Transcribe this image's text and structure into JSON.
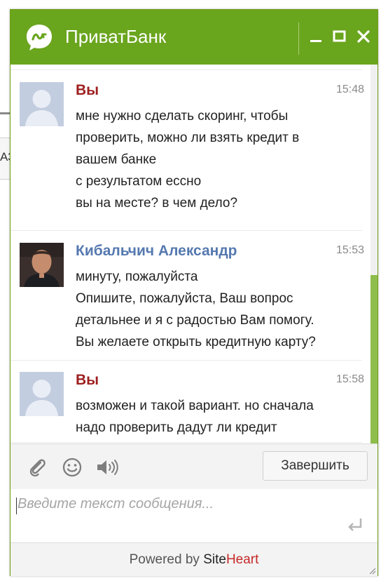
{
  "background": {
    "fragment_text": "АЗ"
  },
  "window": {
    "title": "ПриватБанк",
    "brand_color": "#6aa51e",
    "controls": {
      "minimize_icon": "minimize-icon",
      "maximize_icon": "maximize-icon",
      "close_icon": "close-icon"
    }
  },
  "messages": [
    {
      "author": "Вы",
      "role": "user",
      "time": "15:48",
      "avatar": "default-avatar",
      "lines": [
        "мне нужно сделать скоринг, чтобы",
        "проверить, можно ли взять кредит в",
        "вашем банке",
        "с результатом ессно",
        "вы на месте? в чем дело?"
      ]
    },
    {
      "author": "Кибальчич Александр",
      "role": "agent",
      "time": "15:53",
      "avatar": "agent-photo",
      "lines": [
        "минуту, пожалуйста",
        "Опишите, пожалуйста, Ваш вопрос",
        "детальнее и я с радостью Вам помогу.",
        "Вы желаете открыть кредитную карту?"
      ]
    },
    {
      "author": "Вы",
      "role": "user",
      "time": "15:58",
      "avatar": "default-avatar",
      "lines": [
        "возможен и такой вариант. но сначала",
        "надо проверить дадут ли кредит"
      ]
    }
  ],
  "toolbar": {
    "attach_icon": "paperclip-icon",
    "emoji_icon": "smiley-icon",
    "sound_icon": "speaker-icon",
    "end_label": "Завершить"
  },
  "input": {
    "placeholder": "Введите текст сообщения...",
    "value": "",
    "send_icon": "enter-icon"
  },
  "footer": {
    "prefix": "Powered by ",
    "brand_main": "Site",
    "brand_accent": "Heart"
  }
}
